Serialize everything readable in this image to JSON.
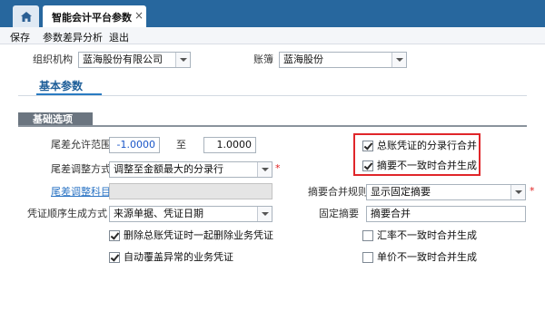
{
  "tabs": {
    "doc_title": "智能会计平台参数",
    "close": "×"
  },
  "menu": {
    "save": "保存",
    "diff": "参数差异分析",
    "exit": "退出"
  },
  "header": {
    "org_label": "组织机构",
    "org_value": "蓝海股份有限公司",
    "book_label": "账簿",
    "book_value": "蓝海股份"
  },
  "section": {
    "tab": "基本参数",
    "group": "基础选项"
  },
  "form": {
    "tolerance_label": "尾差允许范围",
    "tolerance_min": "-1.0000",
    "tolerance_to": "至",
    "tolerance_max": "1.0000",
    "adjust_mode_label": "尾差调整方式",
    "adjust_mode_value": "调整至金额最大的分录行",
    "adjust_subject_label": "尾差调整科目",
    "sequence_label": "凭证顺序生成方式",
    "sequence_value": "来源单据、凭证日期",
    "delete_summary_label": "删除总账凭证时一起删除业务凭证",
    "delete_summary_checked": true,
    "auto_overwrite_label": "自动覆盖异常的业务凭证",
    "auto_overwrite_checked": true,
    "merge_entries_label": "总账凭证的分录行合并",
    "merge_entries_checked": true,
    "abstract_merge_label": "摘要不一致时合并生成",
    "abstract_merge_checked": true,
    "abstract_rule_label": "摘要合并规则",
    "abstract_rule_value": "显示固定摘要",
    "fixed_abstract_label": "固定摘要",
    "fixed_abstract_value": "摘要合并",
    "rate_merge_label": "汇率不一致时合并生成",
    "rate_merge_checked": false,
    "price_merge_label": "单价不一致时合并生成",
    "price_merge_checked": false,
    "required_mark": "*"
  },
  "colors": {
    "tabbar": "#27679e",
    "accent": "#2a7bc2",
    "highlight_box": "#e0262a",
    "number_blue": "#1a56c8"
  }
}
